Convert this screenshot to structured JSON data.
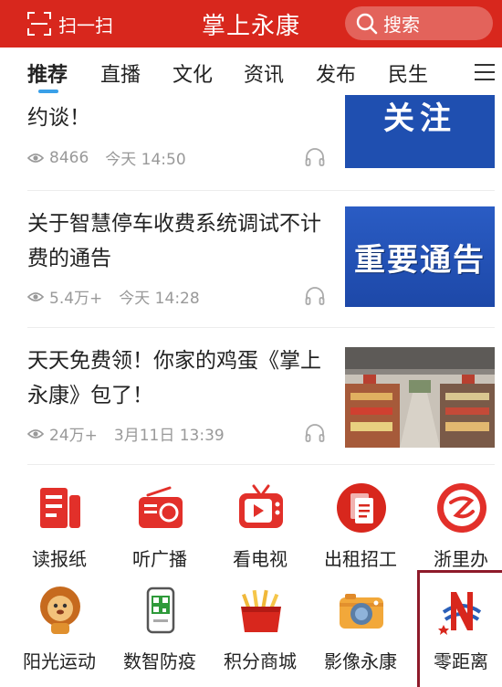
{
  "header": {
    "scan_label": "扫一扫",
    "title": "掌上永康",
    "search_label": "搜索",
    "bg_color": "#d8271d"
  },
  "tabs": [
    {
      "label": "推荐",
      "active": true
    },
    {
      "label": "直播"
    },
    {
      "label": "文化"
    },
    {
      "label": "资讯"
    },
    {
      "label": "发布"
    },
    {
      "label": "民生"
    }
  ],
  "news": [
    {
      "title": "约谈！",
      "views": "8466",
      "time": "今天 14:50",
      "thumb_text": "关注"
    },
    {
      "title": "关于智慧停车收费系统调试不计费的通告",
      "views": "5.4万+",
      "time": "今天 14:28",
      "thumb_text": "重要通告"
    },
    {
      "title": "天天免费领！你家的鸡蛋《掌上永康》包了！",
      "views": "24万+",
      "time": "3月11日 13:39",
      "thumb_text": ""
    }
  ],
  "grid": [
    {
      "label": "读报纸",
      "icon": "newspaper-icon"
    },
    {
      "label": "听广播",
      "icon": "radio-icon"
    },
    {
      "label": "看电视",
      "icon": "tv-icon"
    },
    {
      "label": "出租招工",
      "icon": "document-icon"
    },
    {
      "label": "浙里办",
      "icon": "zheli-logo-icon"
    },
    {
      "label": "阳光运动",
      "icon": "lion-mascot-icon"
    },
    {
      "label": "数智防疫",
      "icon": "qr-phone-icon"
    },
    {
      "label": "积分商城",
      "icon": "gift-box-icon"
    },
    {
      "label": "影像永康",
      "icon": "camera-icon"
    },
    {
      "label": "零距离",
      "icon": "n-logo-icon"
    }
  ]
}
